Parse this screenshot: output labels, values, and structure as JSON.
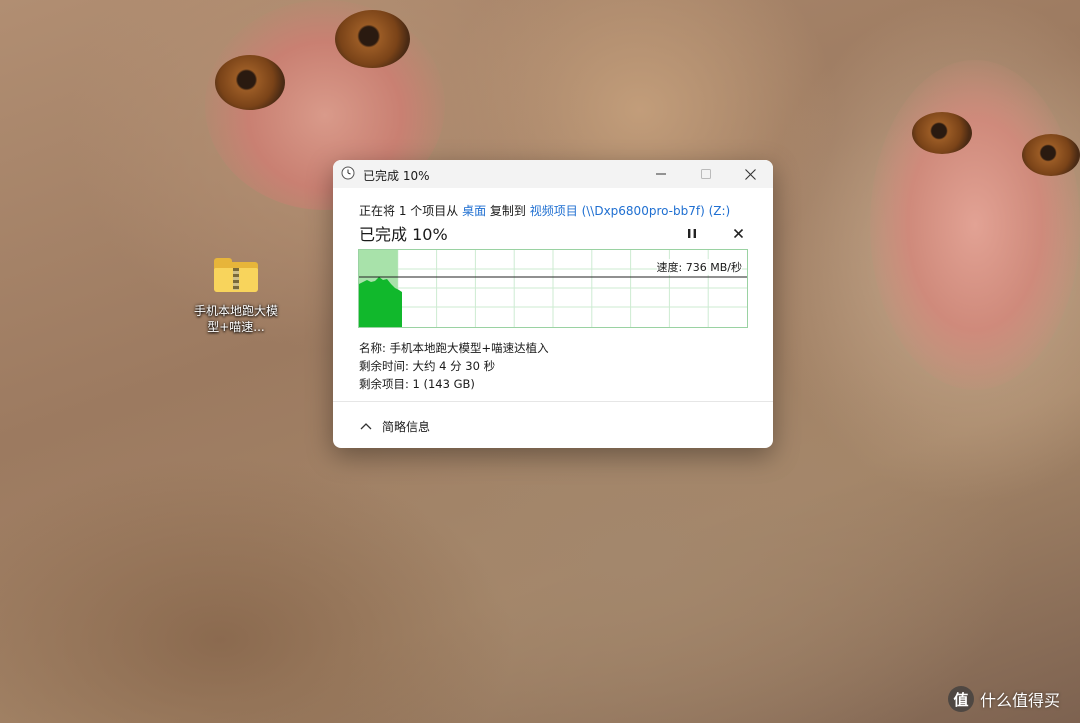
{
  "desktop": {
    "icon_label": "手机本地跑大模型+喵速..."
  },
  "dialog": {
    "title": "已完成 10%",
    "copy_line": {
      "prefix": "正在将 1 个项目从 ",
      "source": "桌面",
      "middle": " 复制到 ",
      "destination": "视频项目 (\\\\Dxp6800pro-bb7f) (Z:)"
    },
    "heading": "已完成 10%",
    "speed_label": "速度: 736 MB/秒",
    "progress_fraction": 0.1,
    "name_line": "名称: 手机本地跑大模型+喵速达植入",
    "time_left_line": "剩余时间: 大约 4 分 30 秒",
    "items_left_line": "剩余项目: 1 (143 GB)",
    "less_details_label": "简略信息",
    "accent_color": "#06b025"
  },
  "watermark": {
    "badge": "值",
    "text": "什么值得买"
  }
}
